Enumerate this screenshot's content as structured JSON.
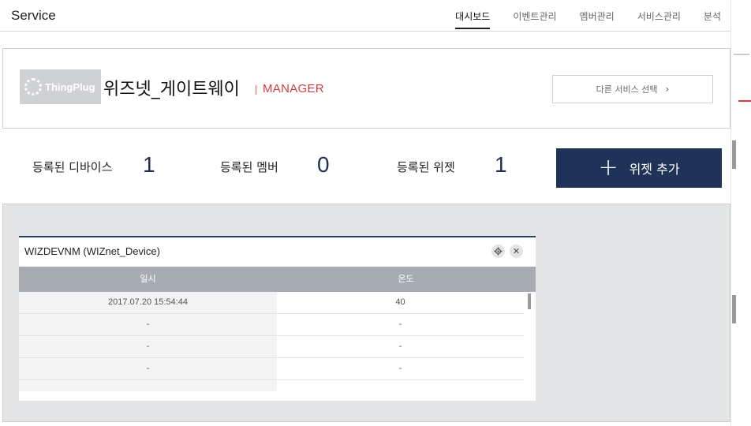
{
  "topbar": {
    "brand": "Service",
    "nav": [
      "대시보드",
      "이벤트관리",
      "멤버관리",
      "서비스관리",
      "분석"
    ]
  },
  "service": {
    "logo_text": "ThingPlug",
    "name": "위즈넷_게이트웨이",
    "role": "MANAGER",
    "other_service_label": "다른 서비스 선택",
    "other_service_icon": "chevron-right-icon"
  },
  "stats": {
    "devices_label": "등록된 디바이스",
    "devices_value": "1",
    "members_label": "등록된 멤버",
    "members_value": "0",
    "widgets_label": "등록된 위젯",
    "widgets_value": "1"
  },
  "add_widget": {
    "label": "위젯 추가",
    "icon": "plus-icon"
  },
  "widget": {
    "title": "WIZDEVNM (WIZnet_Device)",
    "settings_icon": "gear-icon",
    "close_icon": "close-icon",
    "columns": [
      "일시",
      "온도"
    ],
    "rows": [
      [
        "2017.07.20 15:54:44",
        "40"
      ],
      [
        "-",
        "-"
      ],
      [
        "-",
        "-"
      ],
      [
        "-",
        "-"
      ],
      [
        "",
        ""
      ]
    ]
  },
  "colors": {
    "accent": "#1f3358",
    "manager_red": "#d23c3c",
    "table_header": "#a7abb2",
    "dashboard_bg": "#e4e5e7"
  }
}
